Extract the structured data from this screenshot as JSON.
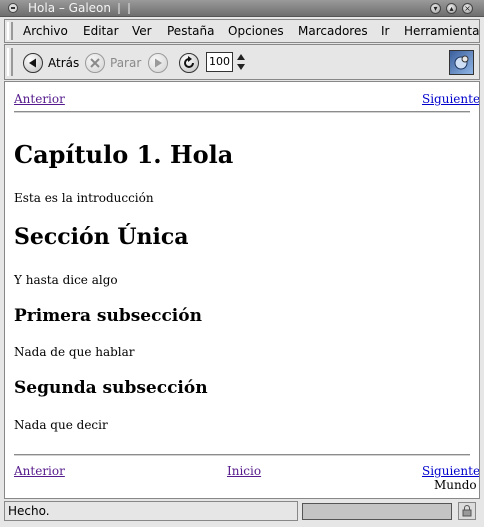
{
  "window": {
    "title": "Hola – Galeon"
  },
  "menu": {
    "items": [
      "Archivo",
      "Editar",
      "Ver",
      "Pestaña",
      "Opciones",
      "Marcadores",
      "Ir",
      "Herramientas"
    ]
  },
  "toolbar": {
    "back_label": "Atrás",
    "stop_label": "Parar",
    "zoom_value": "100"
  },
  "page": {
    "top_nav": {
      "prev": "Anterior",
      "next": "Siguiente"
    },
    "chapter_title": "Capítulo 1. Hola",
    "intro": "Esta es la introducción",
    "section_title": "Sección Única",
    "section_text": "Y hasta dice algo",
    "sub1_title": "Primera subsección",
    "sub1_text": "Nada de que hablar",
    "sub2_title": "Segunda subsección",
    "sub2_text": "Nada que decir",
    "bottom_nav": {
      "prev": "Anterior",
      "home": "Inicio",
      "next": "Siguiente",
      "next_title": "Mundo"
    }
  },
  "status": {
    "text": "Hecho."
  }
}
